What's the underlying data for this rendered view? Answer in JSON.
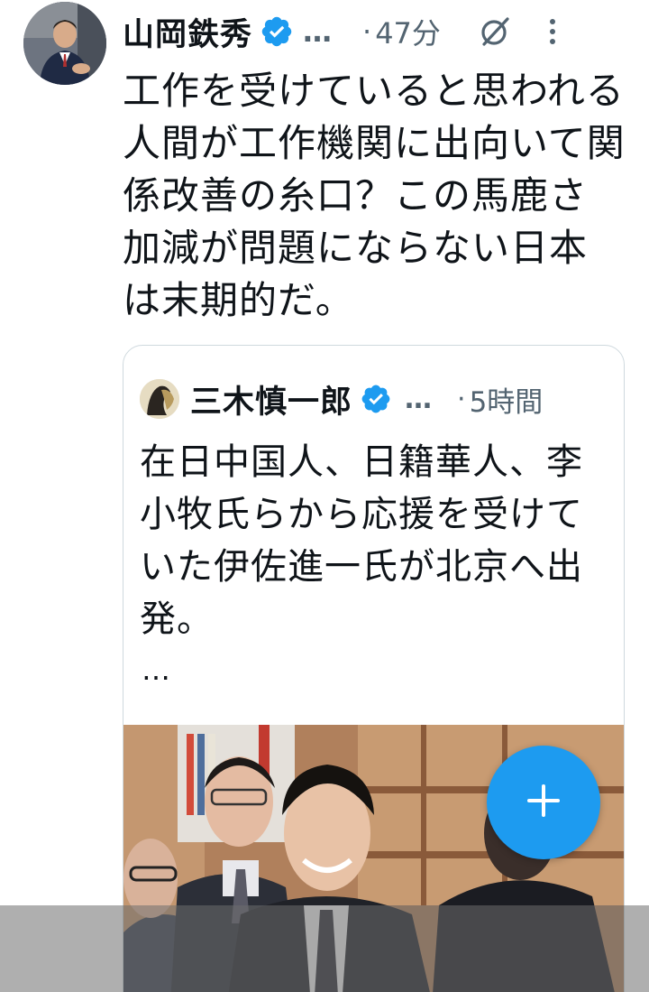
{
  "tweet": {
    "author_name": "山岡鉄秀",
    "handle_ellipsis": "…",
    "separator": "·",
    "time": "47分",
    "text": "工作を受けていると思われる\n人間が工作機関に出向いて関\n係改善の糸口？この馬鹿さ\n加減が問題にならない日本\nは末期的だ。",
    "icons": {
      "avatar": "profile-photo",
      "verified": "verified-badge-icon",
      "grok": "grok-icon",
      "more": "more-vertical-icon"
    }
  },
  "quote": {
    "author_name": "三木慎一郎",
    "handle_ellipsis": "…",
    "separator": "·",
    "time": "5時間",
    "text": "在日中国人、日籍華人、李\n小牧氏らから応援を受けて\nいた伊佐進一氏が北京へ出\n発。",
    "more": "…",
    "icons": {
      "avatar": "profile-photo",
      "verified": "verified-badge-icon",
      "media": "attached-photo"
    }
  },
  "fab": {
    "label": "+",
    "icon": "plus-icon"
  },
  "colors": {
    "accent": "#1d9bf0",
    "text_primary": "#0f1419",
    "text_secondary": "#536471",
    "border": "#cfd9de"
  }
}
